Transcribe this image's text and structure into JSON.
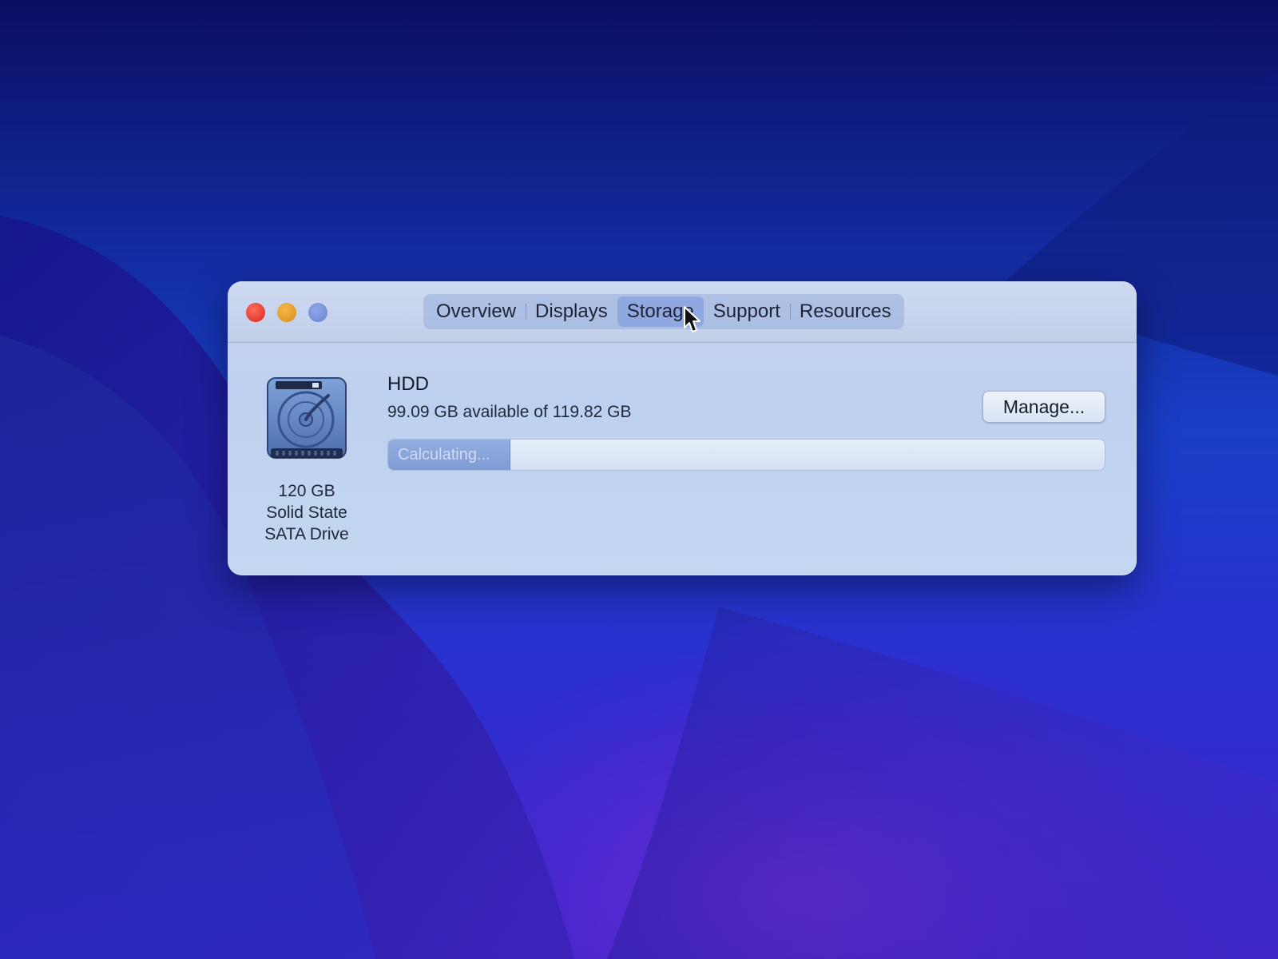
{
  "tabs": [
    {
      "label": "Overview"
    },
    {
      "label": "Displays"
    },
    {
      "label": "Storage",
      "active": true
    },
    {
      "label": "Support"
    },
    {
      "label": "Resources"
    }
  ],
  "disk": {
    "icon": "hard-drive-icon",
    "capacity": "120 GB",
    "type_line1": "Solid State",
    "type_line2": "SATA Drive"
  },
  "volume": {
    "name": "HDD",
    "availability": "99.09 GB available of 119.82 GB",
    "status": "Calculating...",
    "progress_fraction": 0.17
  },
  "manage_button": {
    "label": "Manage..."
  },
  "colors": {
    "close": "#e0392c",
    "minimize": "#e49a2c",
    "zoom": "#7d93da",
    "active_tab": "#8fa8df"
  }
}
